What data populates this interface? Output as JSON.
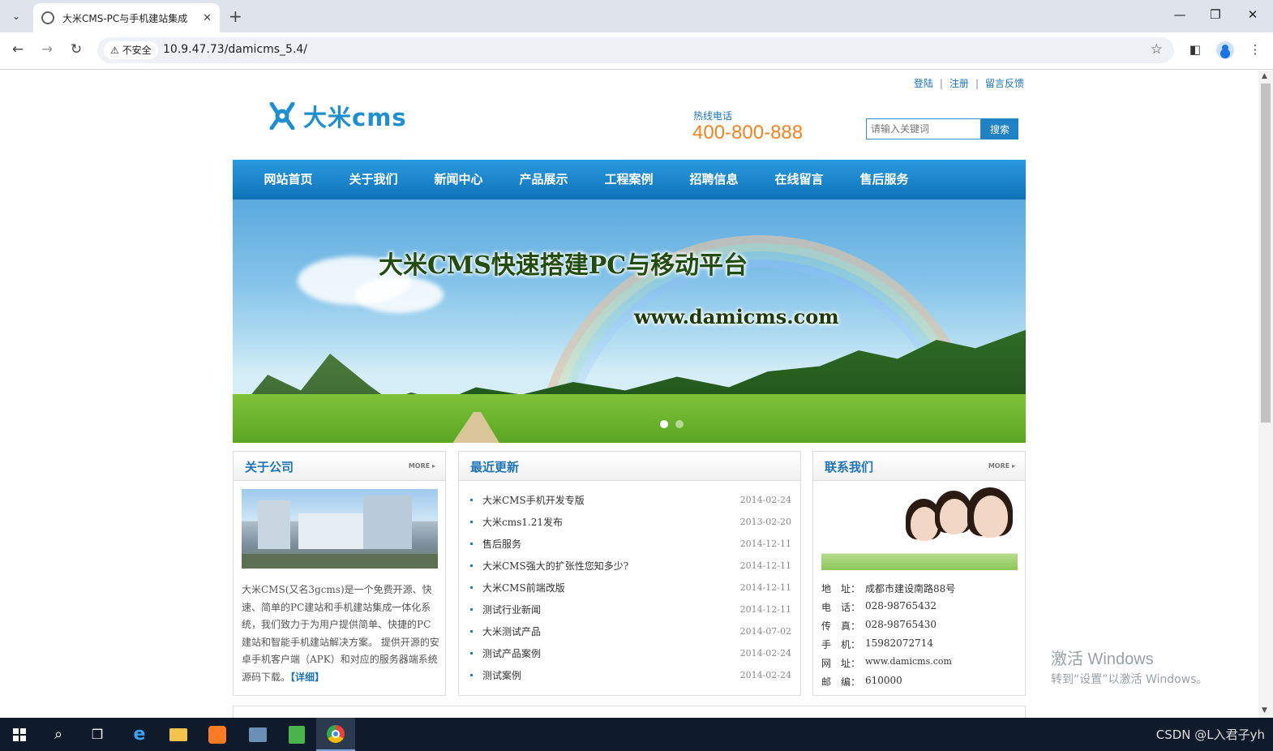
{
  "browser": {
    "tab_title": "大米CMS-PC与手机建站集成",
    "security_label": "不安全",
    "url": "10.9.47.73/damicms_5.4/"
  },
  "site": {
    "top_links": [
      "登陆",
      "注册",
      "留言反馈"
    ],
    "logo_text": "大米cms",
    "hotline_label": "热线电话",
    "hotline": "400-800-888",
    "search_placeholder": "请输入关键词",
    "search_button": "搜索",
    "nav": [
      "网站首页",
      "关于我们",
      "新闻中心",
      "产品展示",
      "工程案例",
      "招聘信息",
      "在线留言",
      "售后服务"
    ],
    "banner": {
      "title": "大米CMS快速搭建PC与移动平台",
      "url": "www.damicms.com",
      "slide_count": 2,
      "active_slide": 1
    },
    "about": {
      "title": "关于公司",
      "more": "MORE ▸",
      "text": "大米CMS(又名3gcms)是一个免费开源、快速、简单的PC建站和手机建站集成一体化系统，我们致力于为用户提供简单、快捷的PC建站和智能手机建站解决方案。 提供开源的安卓手机客户端（APK）和对应的服务器端系统源码下载。",
      "detail": "【详细】"
    },
    "news": {
      "title": "最近更新",
      "items": [
        {
          "title": "大米CMS手机开发专版",
          "date": "2014-02-24"
        },
        {
          "title": "大米cms1.21发布",
          "date": "2013-02-20"
        },
        {
          "title": "售后服务",
          "date": "2014-12-11"
        },
        {
          "title": "大米CMS强大的扩张性您知多少?",
          "date": "2014-12-11"
        },
        {
          "title": "大米CMS前端改版",
          "date": "2014-12-11"
        },
        {
          "title": "测试行业新闻",
          "date": "2014-12-11"
        },
        {
          "title": "大米测试产品",
          "date": "2014-07-02"
        },
        {
          "title": "测试产品案例",
          "date": "2014-02-24"
        },
        {
          "title": "测试案例",
          "date": "2014-02-24"
        }
      ]
    },
    "contact": {
      "title": "联系我们",
      "more": "MORE ▸",
      "rows": [
        {
          "k": "地　址：",
          "v": "成都市建设南路88号"
        },
        {
          "k": "电　话：",
          "v": "028-98765432"
        },
        {
          "k": "传　真：",
          "v": "028-98765430"
        },
        {
          "k": "手　机：",
          "v": "15982072714"
        },
        {
          "k": "网　址：",
          "v": "www.damicms.com"
        },
        {
          "k": "邮　编：",
          "v": "610000"
        }
      ]
    }
  },
  "os": {
    "activation_title": "激活 Windows",
    "activation_sub": "转到“设置”以激活 Windows。",
    "tray_text": "CSDN @L入君子yh"
  }
}
